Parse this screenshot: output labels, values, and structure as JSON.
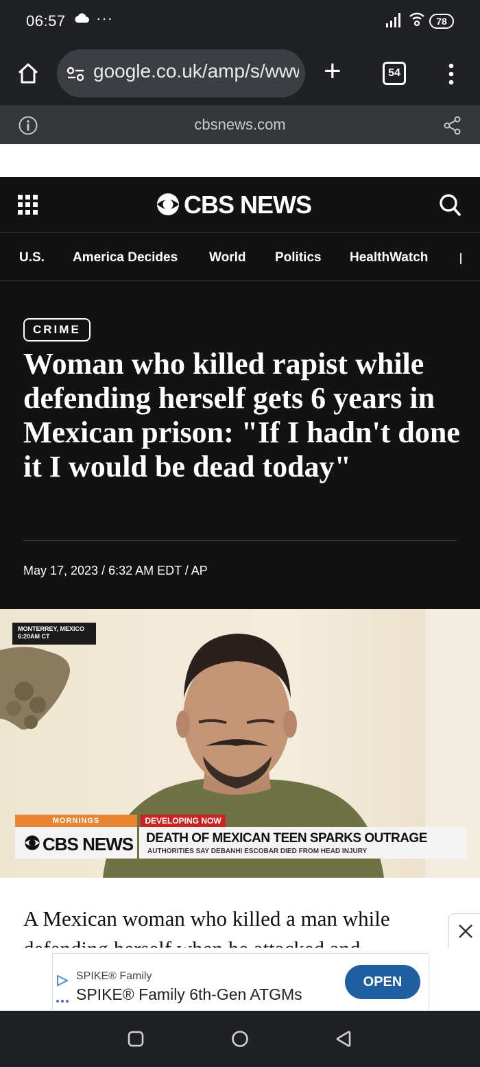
{
  "status_bar": {
    "time": "06:57",
    "overflow": "···",
    "battery": "78"
  },
  "browser": {
    "url": "google.co.uk/amp/s/www.cbsnews.com",
    "tab_count": "54",
    "domain": "cbsnews.com"
  },
  "site": {
    "logo_text": "CBS NEWS",
    "nav": [
      "U.S.",
      "America Decides",
      "World",
      "Politics",
      "HealthWatch"
    ]
  },
  "article": {
    "category": "CRIME",
    "headline": "Woman who killed rapist while defending herself gets 6 years in Mexican prison: \"If I hadn't done it I would be dead today\"",
    "dateline": "May 17, 2023 / 6:32 AM EDT / AP",
    "body_start": "A Mexican woman who killed a man while defending herself when he attacked and"
  },
  "video": {
    "location_line1": "MONTERREY, MEXICO",
    "location_line2": "6:20AM CT",
    "show_tag": "MORNINGS",
    "alert_tag": "DEVELOPING NOW",
    "network": "CBS NEWS",
    "headline": "DEATH OF MEXICAN TEEN SPARKS OUTRAGE",
    "subhead": "AUTHORITIES SAY DEBANHI ESCOBAR DIED FROM HEAD INJURY"
  },
  "ad": {
    "advertiser": "SPIKE® Family",
    "title": "SPIKE® Family 6th-Gen ATGMs",
    "cta": "OPEN"
  },
  "colors": {
    "chrome_bg": "#202124",
    "cbs_bg": "#121212",
    "ad_button": "#1f5fa0",
    "tag_orange": "#e88532",
    "tag_red": "#cc2222"
  }
}
